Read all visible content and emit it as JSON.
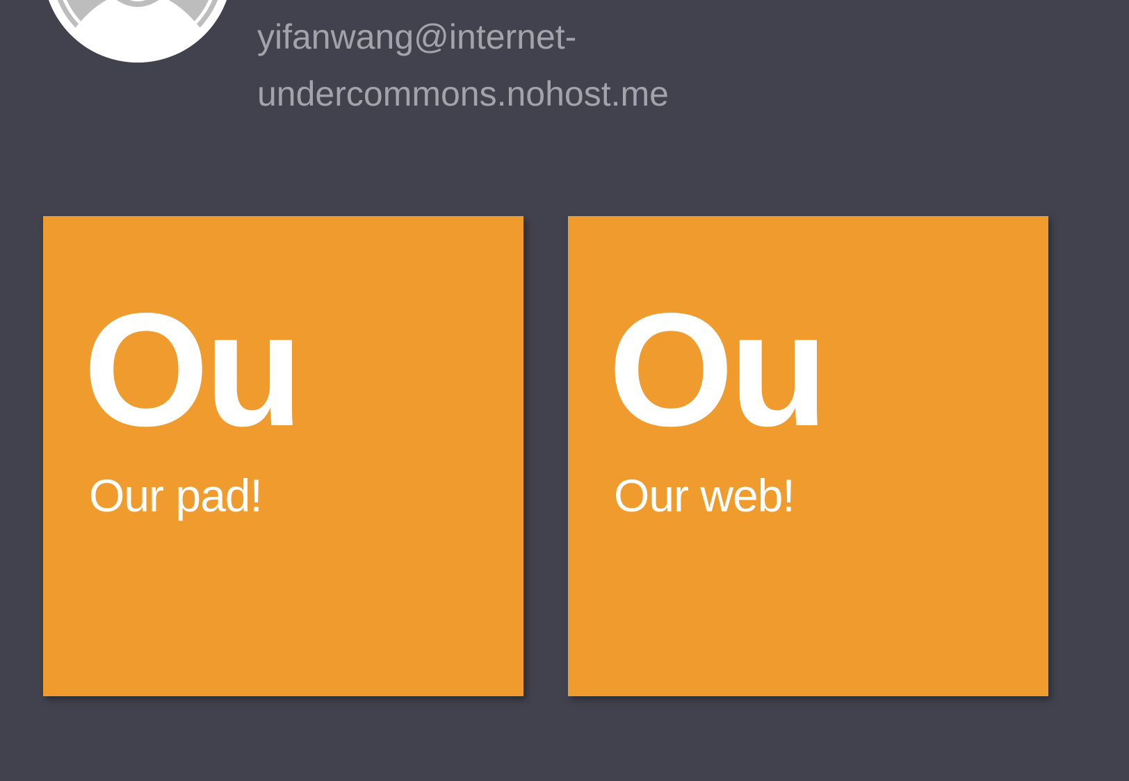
{
  "user": {
    "avatar_icon": "user-avatar-icon",
    "email_line1": "yifanwang@internet-",
    "email_line2": "undercommons.nohost.me"
  },
  "apps": [
    {
      "abbr": "Ou",
      "label": "Our pad!"
    },
    {
      "abbr": "Ou",
      "label": "Our web!"
    }
  ],
  "colors": {
    "background": "#41424d",
    "tile": "#f09b2e",
    "email_text": "#a3a4ab",
    "tile_text": "#ffffff"
  }
}
